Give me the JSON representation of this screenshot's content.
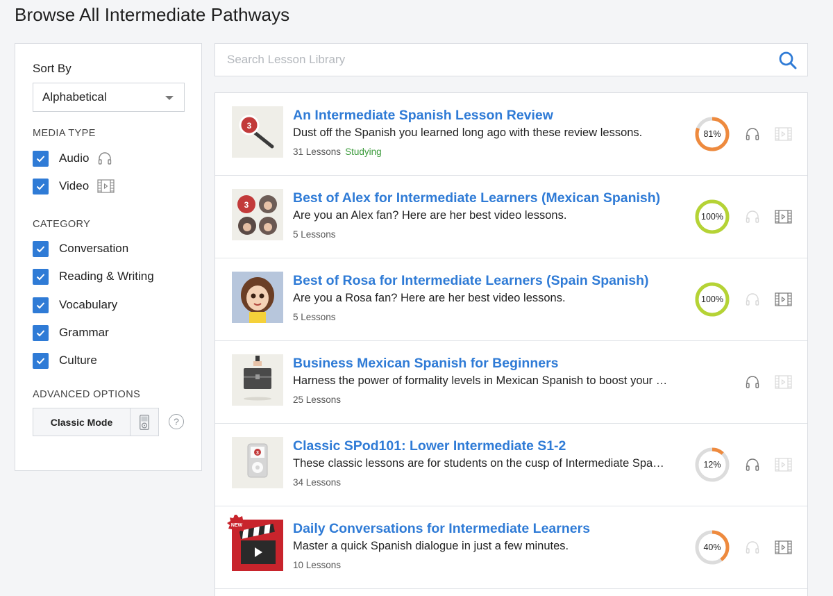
{
  "page": {
    "title": "Browse All Intermediate Pathways"
  },
  "sidebar": {
    "sort_label": "Sort By",
    "sort_value": "Alphabetical",
    "media_type_heading": "MEDIA TYPE",
    "media_types": [
      {
        "label": "Audio",
        "checked": true,
        "icon": "headphones-icon"
      },
      {
        "label": "Video",
        "checked": true,
        "icon": "film-icon"
      }
    ],
    "category_heading": "CATEGORY",
    "categories": [
      {
        "label": "Conversation",
        "checked": true
      },
      {
        "label": "Reading & Writing",
        "checked": true
      },
      {
        "label": "Vocabulary",
        "checked": true
      },
      {
        "label": "Grammar",
        "checked": true
      },
      {
        "label": "Culture",
        "checked": true
      }
    ],
    "advanced_heading": "ADVANCED OPTIONS",
    "classic_mode_label": "Classic Mode",
    "help_label": "?"
  },
  "search": {
    "placeholder": "Search Lesson Library",
    "value": ""
  },
  "colors": {
    "accent": "#2f7bd6",
    "progress_orange": "#ee8a3e",
    "progress_green": "#b5d335",
    "status_green": "#3a9a3a"
  },
  "pathways": [
    {
      "title": "An Intermediate Spanish Lesson Review",
      "description": "Dust off the Spanish you learned long ago with these review lessons.",
      "lessons": "31 Lessons",
      "status": "Studying",
      "progress": 81,
      "progress_label": "81%",
      "audio": true,
      "video": false,
      "thumb": "magnifier-thumbnail"
    },
    {
      "title": "Best of Alex for Intermediate Learners (Mexican Spanish)",
      "description": "Are you an Alex fan? Here are her best video lessons.",
      "lessons": "5 Lessons",
      "status": "",
      "progress": 100,
      "progress_label": "100%",
      "audio": false,
      "video": true,
      "thumb": "host-collage-thumbnail"
    },
    {
      "title": "Best of Rosa for Intermediate Learners (Spain Spanish)",
      "description": "Are you a Rosa fan? Here are her best video lessons.",
      "lessons": "5 Lessons",
      "status": "",
      "progress": 100,
      "progress_label": "100%",
      "audio": false,
      "video": true,
      "thumb": "cartoon-host-thumbnail"
    },
    {
      "title": "Business Mexican Spanish for Beginners",
      "description": "Harness the power of formality levels in Mexican Spanish to boost your …",
      "lessons": "25 Lessons",
      "status": "",
      "progress": null,
      "progress_label": "",
      "audio": true,
      "video": false,
      "thumb": "briefcase-thumbnail"
    },
    {
      "title": "Classic SPod101: Lower Intermediate S1-2",
      "description": "These classic lessons are for students on the cusp of Intermediate Spa…",
      "lessons": "34 Lessons",
      "status": "",
      "progress": 12,
      "progress_label": "12%",
      "audio": true,
      "video": false,
      "thumb": "ipod-thumbnail"
    },
    {
      "title": "Daily Conversations for Intermediate Learners",
      "description": "Master a quick Spanish dialogue in just a few minutes.",
      "lessons": "10 Lessons",
      "status": "",
      "progress": 40,
      "progress_label": "40%",
      "audio": false,
      "video": true,
      "thumb": "clapperboard-thumbnail",
      "badge": "NEW"
    }
  ]
}
